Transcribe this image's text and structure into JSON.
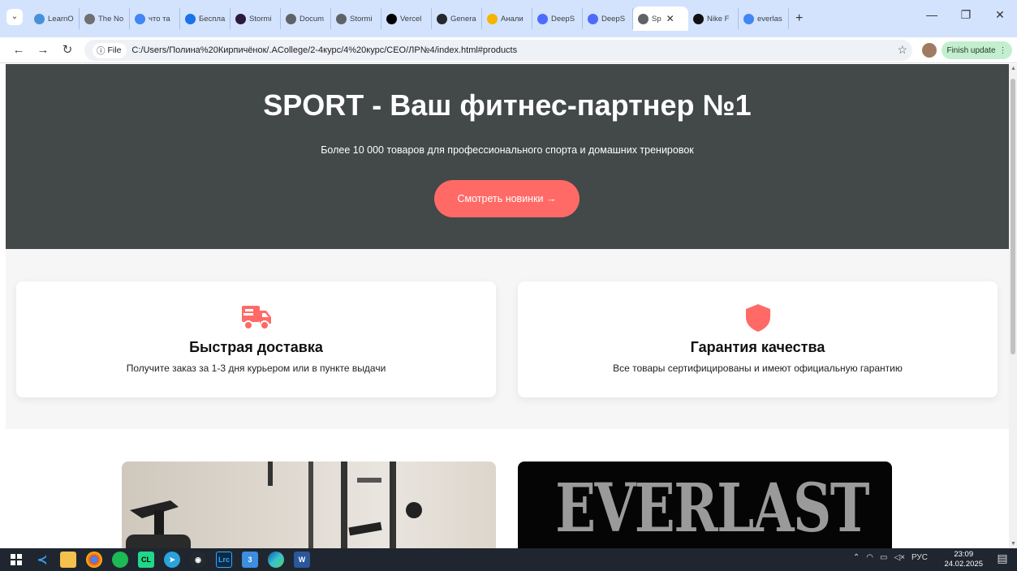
{
  "browser": {
    "tabs": [
      {
        "label": "LearnO",
        "color": "#4a90d9"
      },
      {
        "label": "The No",
        "color": "#6f6f6f"
      },
      {
        "label": "что та",
        "color": "#4285f4"
      },
      {
        "label": "Беспла",
        "color": "#1a73e8"
      },
      {
        "label": "Stormi",
        "color": "#2b1a3c"
      },
      {
        "label": "Docum",
        "color": "#5f6368"
      },
      {
        "label": "Stormi",
        "color": "#5f6368"
      },
      {
        "label": "Vercel",
        "color": "#000000"
      },
      {
        "label": "Genera",
        "color": "#24292e"
      },
      {
        "label": "Анали",
        "color": "#f4b400"
      },
      {
        "label": "DeepS",
        "color": "#4d6bfe"
      },
      {
        "label": "DeepS",
        "color": "#4d6bfe"
      },
      {
        "label": "Sp",
        "color": "#5f6368",
        "active": true
      },
      {
        "label": "Nike F",
        "color": "#111111"
      },
      {
        "label": "everlas",
        "color": "#4285f4"
      }
    ],
    "new_tab": "+",
    "address": {
      "chip_label": "File",
      "url": "C:/Users/Полина%20Кирпичёнок/.ACollege/2-4курс/4%20курс/CEO/ЛР№4/index.html#products"
    },
    "finish_update": "Finish update"
  },
  "hero": {
    "title": "SPORT - Ваш фитнес-партнер №1",
    "subtitle": "Более 10 000 товаров для профессионального спорта и домашних тренировок",
    "cta": "Смотреть новинки →"
  },
  "features": [
    {
      "icon": "delivery-truck-icon",
      "title": "Быстрая доставка",
      "text": "Получите заказ за 1-3 дня курьером или в пункте выдачи"
    },
    {
      "icon": "shield-icon",
      "title": "Гарантия качества",
      "text": "Все товары сертифицированы и имеют официальную гарантию"
    }
  ],
  "products": [
    {
      "image": "gym-equipment-photo"
    },
    {
      "image": "everlast-logo-photo",
      "logo_text": "EVERLAST"
    }
  ],
  "taskbar": {
    "lang": "РУС",
    "time": "23:09",
    "date": "24.02.2025"
  },
  "colors": {
    "accent": "#ff6a66",
    "hero_bg": "#434849",
    "tabbar_bg": "#d3e3fd"
  }
}
